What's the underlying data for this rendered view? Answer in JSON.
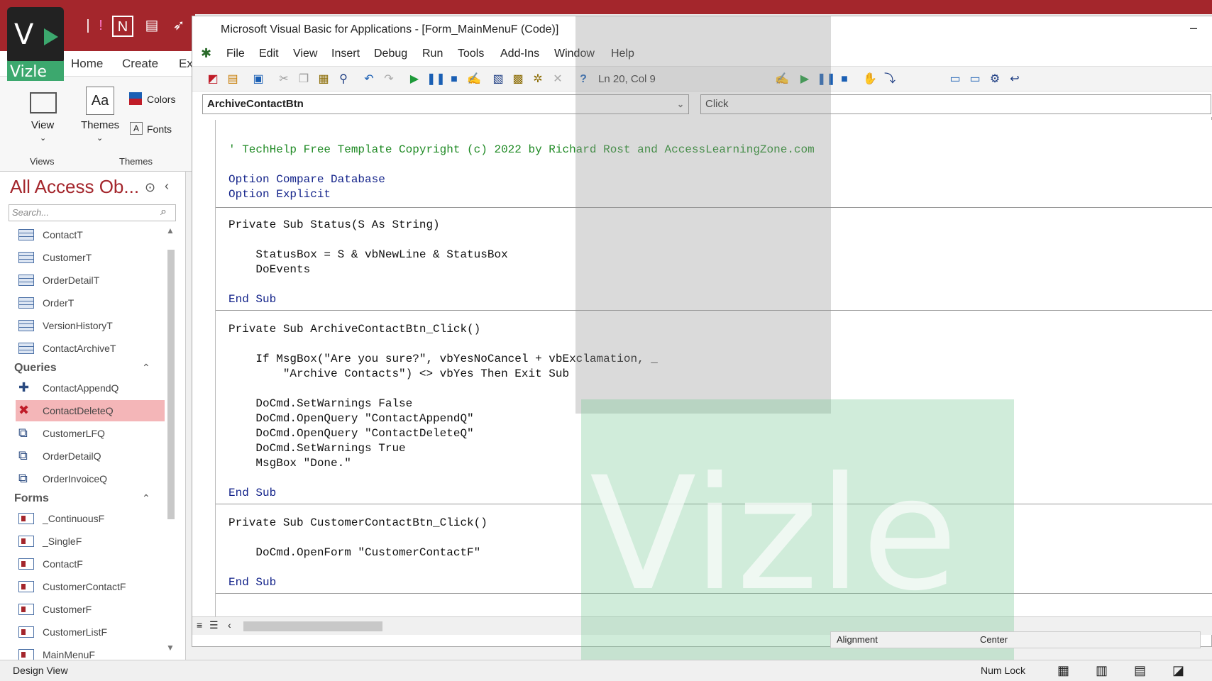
{
  "vbe": {
    "title": "Microsoft Visual Basic for Applications - [Form_MainMenuF (Code)]",
    "menu": [
      "File",
      "Edit",
      "View",
      "Insert",
      "Debug",
      "Run",
      "Tools",
      "Add-Ins",
      "Window",
      "Help"
    ],
    "position": "Ln 20, Col 9",
    "object_combo": "ArchiveContactBtn",
    "proc_combo": "Click"
  },
  "access": {
    "tabs": [
      "Home",
      "Create",
      "Ex"
    ],
    "views_label": "View",
    "views_group": "Views",
    "themes_label": "Themes",
    "themes_group": "Themes",
    "colors_label": "Colors",
    "fonts_label": "Fonts"
  },
  "nav": {
    "title": "All Access Ob...",
    "search_placeholder": "Search...",
    "tables": [
      "ContactT",
      "CustomerT",
      "OrderDetailT",
      "OrderT",
      "VersionHistoryT",
      "ContactArchiveT"
    ],
    "queries_header": "Queries",
    "queries": [
      "ContactAppendQ",
      "ContactDeleteQ",
      "CustomerLFQ",
      "OrderDetailQ",
      "OrderInvoiceQ"
    ],
    "forms_header": "Forms",
    "forms": [
      "_ContinuousF",
      "_SingleF",
      "ContactF",
      "CustomerContactF",
      "CustomerF",
      "CustomerListF",
      "MainMenuF"
    ]
  },
  "code": [
    "' TechHelp Free Template Copyright (c) 2022 by Richard Rost and AccessLearningZone.com",
    "",
    "Option Compare Database",
    "Option Explicit",
    "",
    "Private Sub Status(S As String)",
    "",
    "    StatusBox = S & vbNewLine & StatusBox",
    "    DoEvents",
    "",
    "End Sub",
    "",
    "Private Sub ArchiveContactBtn_Click()",
    "",
    "    If MsgBox(\"Are you sure?\", vbYesNoCancel + vbExclamation, _",
    "        \"Archive Contacts\") <> vbYes Then Exit Sub",
    "",
    "    DoCmd.SetWarnings False",
    "    DoCmd.OpenQuery \"ContactAppendQ\"",
    "    DoCmd.OpenQuery \"ContactDeleteQ\"",
    "    DoCmd.SetWarnings True",
    "    MsgBox \"Done.\"",
    "",
    "End Sub",
    "",
    "Private Sub CustomerContactBtn_Click()",
    "",
    "    DoCmd.OpenForm \"CustomerContactF\"",
    "",
    "End Sub"
  ],
  "props": {
    "label": "Alignment",
    "value": "Center"
  },
  "status": {
    "left": "Design View",
    "numlock": "Num Lock"
  },
  "watermark": "Vizle"
}
